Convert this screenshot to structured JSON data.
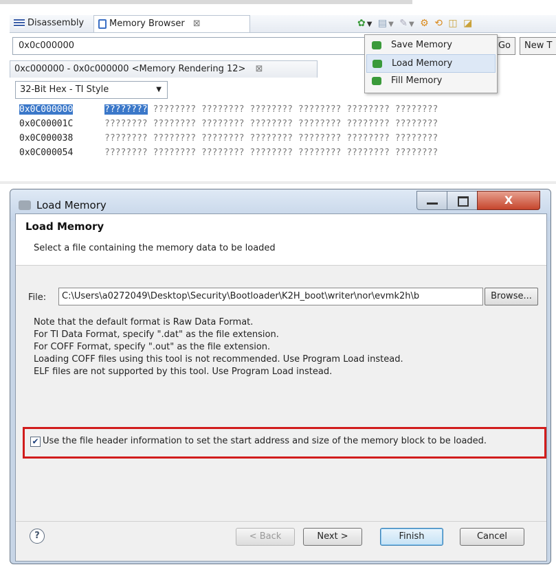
{
  "memory_browser": {
    "tabs": [
      {
        "label": "Disassembly"
      },
      {
        "label": "Memory Browser",
        "close": "⊠"
      }
    ],
    "address_input": "0x0c000000",
    "go_label": "Go",
    "new_tab_label": "New T",
    "rendering_tab": "0xc000000 - 0x0c000000 <Memory Rendering 12>",
    "rendering_tab_close": "⊠",
    "format_select": "32-Bit Hex - TI Style",
    "rows": [
      {
        "address": "0x0C000000",
        "words": "???????? ???????? ???????? ???????? ???????? ???????? ????????",
        "first": "????????"
      },
      {
        "address": "0x0C00001C",
        "words": "???????? ???????? ???????? ???????? ???????? ???????? ????????"
      },
      {
        "address": "0x0C000038",
        "words": "???????? ???????? ???????? ???????? ???????? ???????? ????????"
      },
      {
        "address": "0x0C000054",
        "words": "???????? ???????? ???????? ???????? ???????? ???????? ????????"
      }
    ],
    "toolbar_icons": [
      "memory-action-icon",
      "dropdown-arrow-icon",
      "import-icon",
      "dropdown-arrow-icon",
      "pin-icon",
      "dropdown-arrow-icon",
      "link-icon",
      "refresh-icon",
      "new-view-icon",
      "view-menu-icon"
    ],
    "menu": {
      "items": [
        {
          "label": "Save Memory"
        },
        {
          "label": "Load Memory",
          "highlighted": true
        },
        {
          "label": "Fill Memory"
        }
      ]
    }
  },
  "dialog": {
    "title": "Load Memory",
    "header_title": "Load Memory",
    "header_desc": "Select a file containing the memory data to be loaded",
    "file_label": "File:",
    "file_value": "C:\\Users\\a0272049\\Desktop\\Security\\Bootloader\\K2H_boot\\writer\\nor\\evmk2h\\b",
    "browse_label": "Browse...",
    "notes": [
      "Note that the default format is Raw Data Format.",
      "For TI Data Format, specify \".dat\" as the file extension.",
      "For COFF Format, specify \".out\" as the file extension.",
      "Loading COFF files using this tool is not recommended. Use Program Load instead.",
      "ELF files are not supported by this tool. Use Program Load instead."
    ],
    "checkbox_checked": true,
    "checkbox_label": "Use the file header information to set the start address and size of the memory block to be loaded.",
    "buttons": {
      "help": "?",
      "back": "< Back",
      "next": "Next >",
      "finish": "Finish",
      "cancel": "Cancel"
    },
    "window_controls": {
      "close": "X"
    }
  }
}
